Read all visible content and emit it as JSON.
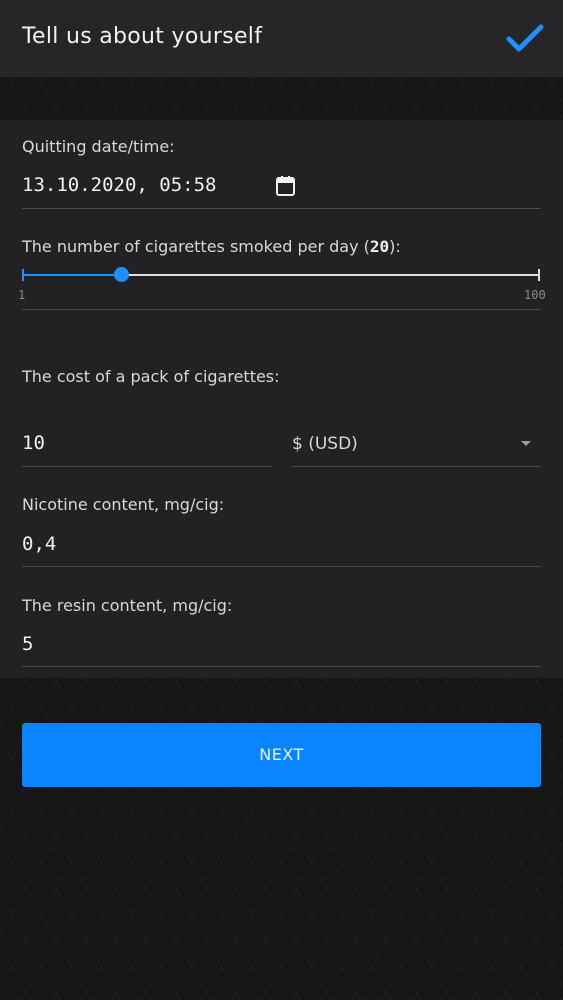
{
  "header": {
    "title": "Tell us about yourself",
    "confirm_icon": "check-icon",
    "accent_color": "#1e90ff"
  },
  "quit_date": {
    "label": "Quitting date/time:",
    "value": "13.10.2020, 05:58",
    "icon": "calendar-icon"
  },
  "cigarettes": {
    "label_prefix": "The number of cigarettes smoked per day (",
    "label_value": "20",
    "label_suffix": "):",
    "min": "1",
    "max": "100",
    "value": 20
  },
  "cost": {
    "label": "The cost of a pack of cigarettes:",
    "value": "10",
    "currency": "$ (USD)"
  },
  "nicotine": {
    "label": "Nicotine content, mg/cig:",
    "value": "0,4"
  },
  "resin": {
    "label": "The resin content, mg/cig:",
    "value": "5"
  },
  "next_button": {
    "label": "NEXT",
    "color": "#0a84ff"
  }
}
